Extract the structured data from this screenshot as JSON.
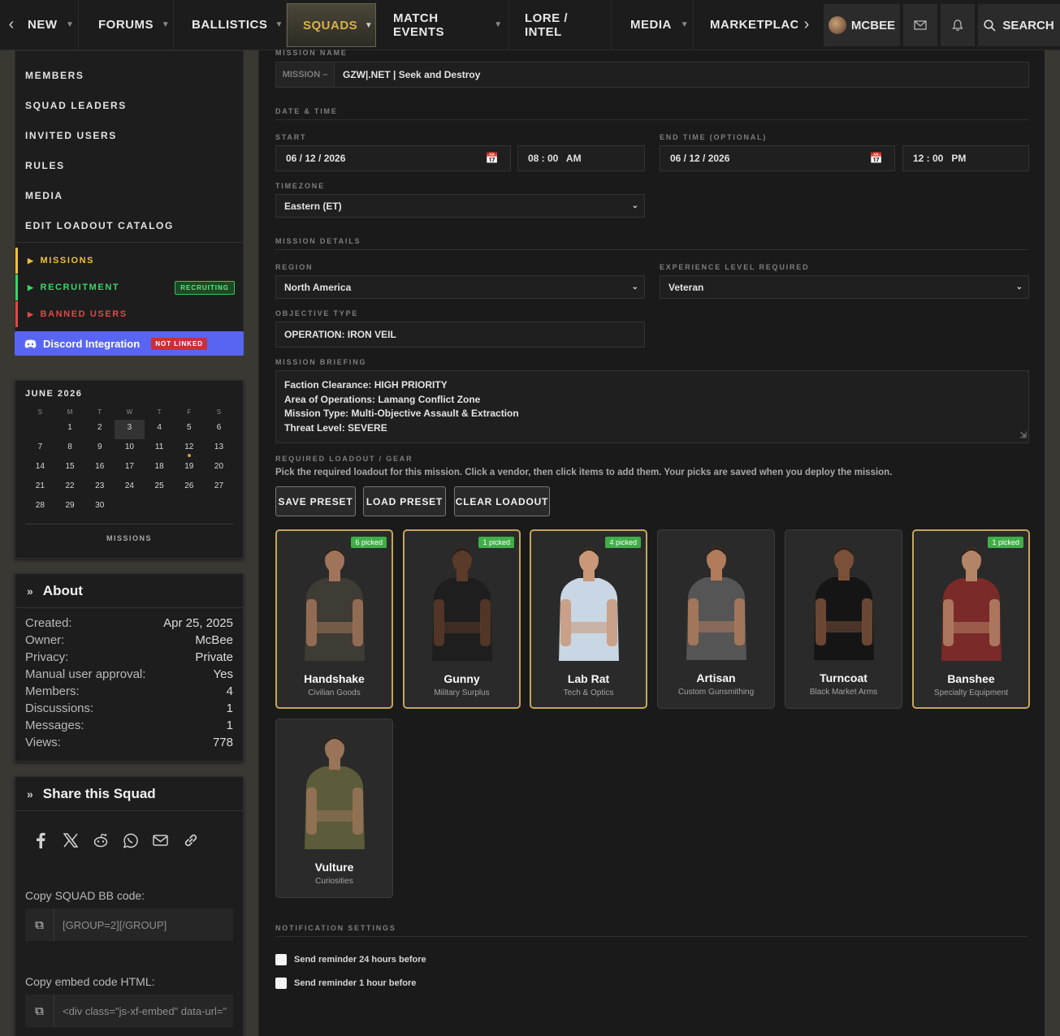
{
  "nav": {
    "items": [
      {
        "label": "NEW"
      },
      {
        "label": "FORUMS"
      },
      {
        "label": "BALLISTICS"
      },
      {
        "label": "SQUADS"
      },
      {
        "label": "MATCH EVENTS"
      },
      {
        "label": "LORE / INTEL"
      },
      {
        "label": "MEDIA"
      },
      {
        "label": "MARKETPLACE"
      }
    ],
    "user": "MCBEE",
    "search": "SEARCH"
  },
  "sidebar": {
    "links": [
      "MEMBERS",
      "SQUAD LEADERS",
      "INVITED USERS",
      "RULES",
      "MEDIA",
      "EDIT LOADOUT CATALOG"
    ],
    "subs": [
      {
        "label": "MISSIONS",
        "color": "#f0c040"
      },
      {
        "label": "RECRUITMENT",
        "color": "#3fd36a",
        "badge": "RECRUITING"
      },
      {
        "label": "BANNED USERS",
        "color": "#e04848"
      }
    ],
    "discord": {
      "label": "Discord Integration",
      "badge": "NOT LINKED"
    }
  },
  "calendar": {
    "title": "JUNE 2026",
    "weekdays": [
      "S",
      "M",
      "T",
      "W",
      "T",
      "F",
      "S"
    ],
    "weeks": [
      [
        "",
        "1",
        "2",
        "3",
        "4",
        "5",
        "6"
      ],
      [
        "7",
        "8",
        "9",
        "10",
        "11",
        "12",
        "13"
      ],
      [
        "14",
        "15",
        "16",
        "17",
        "18",
        "19",
        "20"
      ],
      [
        "21",
        "22",
        "23",
        "24",
        "25",
        "26",
        "27"
      ],
      [
        "28",
        "29",
        "30",
        "",
        "",
        "",
        ""
      ]
    ],
    "today": "3",
    "event_day": "12",
    "footer": "MISSIONS"
  },
  "about": {
    "title": "About",
    "rows": [
      {
        "k": "Created:",
        "v": "Apr 25, 2025"
      },
      {
        "k": "Owner:",
        "v": "McBee"
      },
      {
        "k": "Privacy:",
        "v": "Private"
      },
      {
        "k": "Manual user approval:",
        "v": "Yes"
      },
      {
        "k": "Members:",
        "v": "4"
      },
      {
        "k": "Discussions:",
        "v": "1"
      },
      {
        "k": "Messages:",
        "v": "1"
      },
      {
        "k": "Views:",
        "v": "778"
      }
    ]
  },
  "share": {
    "title": "Share this Squad",
    "icons": [
      "facebook-icon",
      "x-icon",
      "reddit-icon",
      "whatsapp-icon",
      "email-icon",
      "link-icon"
    ],
    "bb_label": "Copy SQUAD BB code:",
    "bb_value": "[GROUP=2][/GROUP]",
    "embed_label": "Copy embed code HTML:",
    "embed_value": "<div class=\"js-xf-embed\" data-url=\""
  },
  "form": {
    "mission_name_label": "MISSION NAME",
    "mission_prefix": "MISSION –",
    "mission_name": "GZW|.NET | Seek and Destroy",
    "date_time_label": "DATE & TIME",
    "start_label": "START",
    "start_date": "06 / 12 / 2026",
    "start_time": "08 : 00   AM",
    "end_label": "END TIME (OPTIONAL)",
    "end_date": "06 / 12 / 2026",
    "end_time": "12 : 00   PM",
    "timezone_label": "TIMEZONE",
    "timezone": "Eastern (ET)",
    "details_label": "MISSION DETAILS",
    "region_label": "REGION",
    "region": "North America",
    "exp_label": "EXPERIENCE LEVEL REQUIRED",
    "exp": "Veteran",
    "objective_label": "OBJECTIVE TYPE",
    "objective": "OPERATION: IRON VEIL",
    "briefing_label": "MISSION BRIEFING",
    "briefing": [
      "Faction Clearance: HIGH PRIORITY",
      "Area of Operations: Lamang Conflict Zone",
      "Mission Type: Multi-Objective Assault & Extraction",
      "Threat Level: SEVERE"
    ],
    "loadout_label": "REQUIRED LOADOUT / GEAR",
    "loadout_help": "Pick the required loadout for this mission. Click a vendor, then click items to add them. Your picks are saved when you deploy the mission.",
    "buttons": {
      "save": "SAVE PRESET",
      "load": "LOAD PRESET",
      "clear": "CLEAR LOADOUT"
    },
    "notif_label": "NOTIFICATION SETTINGS",
    "notif_24": "Send reminder 24 hours before",
    "notif_1": "Send reminder 1 hour before"
  },
  "vendors": [
    {
      "name": "Handshake",
      "sub": "Civilian Goods",
      "picked": "6 picked",
      "skin": "#a0745a",
      "shirt": "#3e3c34"
    },
    {
      "name": "Gunny",
      "sub": "Military Surplus",
      "picked": "1 picked",
      "skin": "#5a3a28",
      "shirt": "#1e1e1e"
    },
    {
      "name": "Lab Rat",
      "sub": "Tech & Optics",
      "picked": "4 picked",
      "skin": "#c89878",
      "shirt": "#c9d6e4"
    },
    {
      "name": "Artisan",
      "sub": "Custom Gunsmithing",
      "picked": "",
      "skin": "#b07c5c",
      "shirt": "#555555"
    },
    {
      "name": "Turncoat",
      "sub": "Black Market Arms",
      "picked": "",
      "skin": "#7a5038",
      "shirt": "#151515"
    },
    {
      "name": "Banshee",
      "sub": "Specialty Equipment",
      "picked": "1 picked",
      "skin": "#b48466",
      "shirt": "#7a2a28"
    },
    {
      "name": "Vulture",
      "sub": "Curiosities",
      "picked": "",
      "skin": "#9a7458",
      "shirt": "#5c5c3a"
    }
  ],
  "colors": {
    "accent": "#d9b24a",
    "pick": "#3fae47",
    "discord": "#5865f2"
  }
}
